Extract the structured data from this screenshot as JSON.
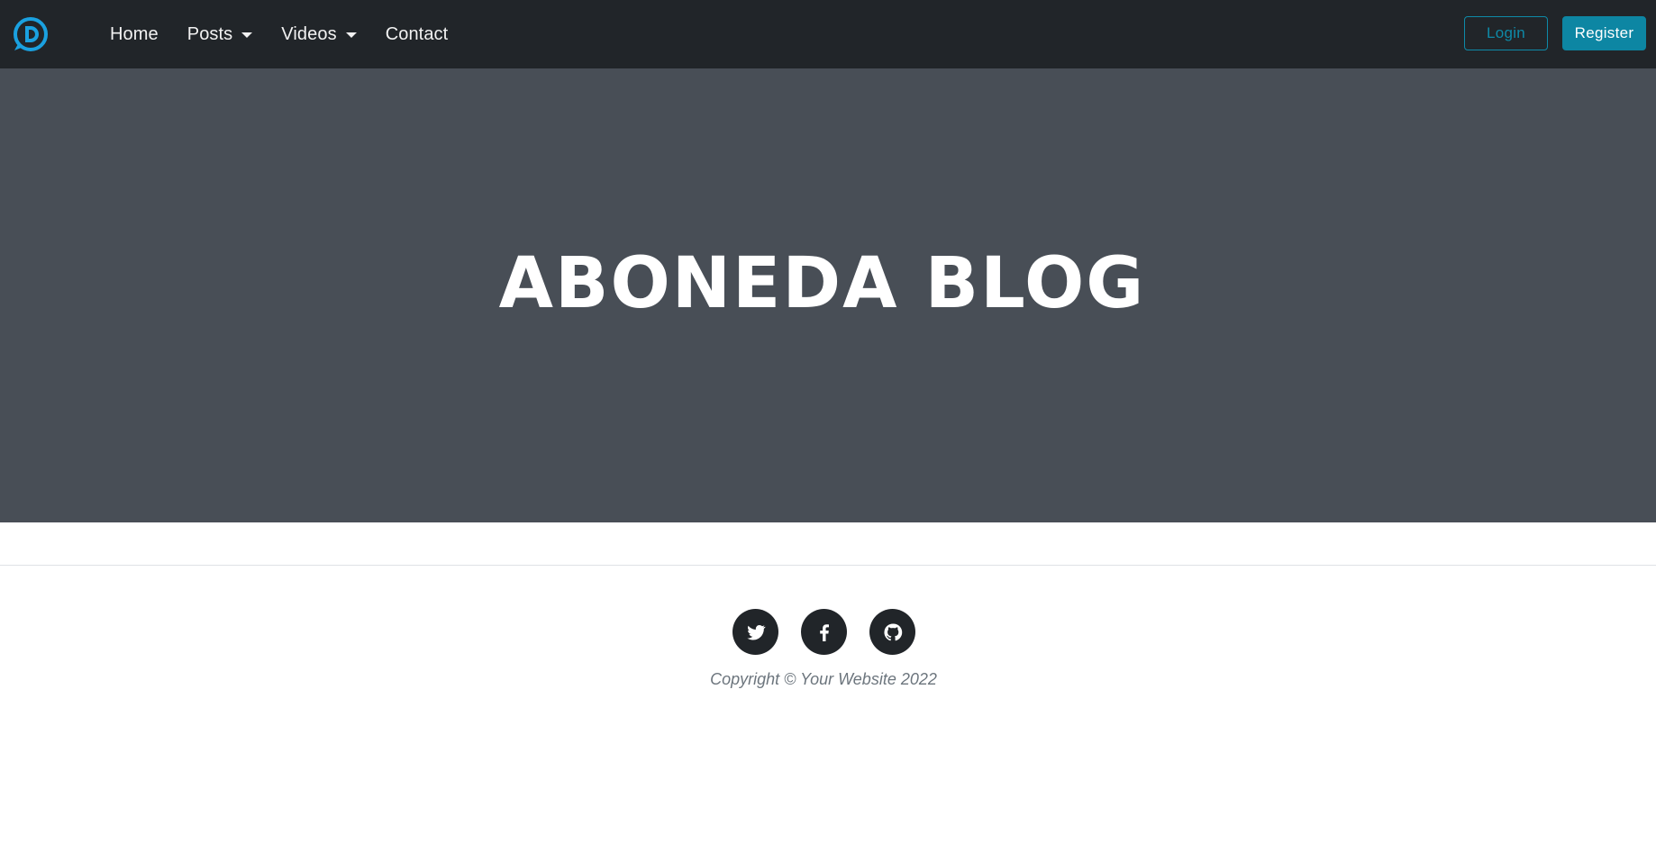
{
  "brand": {
    "icon": "disqus-logo-icon",
    "color": "#1aa1e0"
  },
  "nav": {
    "items": [
      {
        "label": "Home",
        "dropdown": false
      },
      {
        "label": "Posts",
        "dropdown": true
      },
      {
        "label": "Videos",
        "dropdown": true
      },
      {
        "label": "Contact",
        "dropdown": false
      }
    ]
  },
  "auth": {
    "login_label": "Login",
    "register_label": "Register",
    "accent": "#0d86a3"
  },
  "hero": {
    "title": "ABONEDA BLOG",
    "background": "#484e56"
  },
  "footer": {
    "social": [
      "twitter-icon",
      "facebook-icon",
      "github-icon"
    ],
    "copyright": "Copyright © Your Website 2022"
  }
}
